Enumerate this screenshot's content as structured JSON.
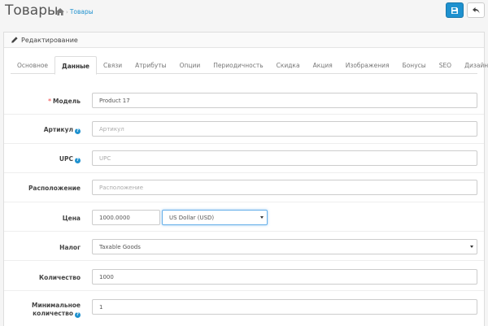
{
  "header": {
    "title": "Товары",
    "breadcrumb_sep": "›",
    "breadcrumb_link": "Товары"
  },
  "panel": {
    "title": "Редактирование"
  },
  "tabs": [
    {
      "label": "Основное",
      "active": false
    },
    {
      "label": "Данные",
      "active": true
    },
    {
      "label": "Связи",
      "active": false
    },
    {
      "label": "Атрибуты",
      "active": false
    },
    {
      "label": "Опции",
      "active": false
    },
    {
      "label": "Периодичность",
      "active": false
    },
    {
      "label": "Скидка",
      "active": false
    },
    {
      "label": "Акция",
      "active": false
    },
    {
      "label": "Изображения",
      "active": false
    },
    {
      "label": "Бонусы",
      "active": false
    },
    {
      "label": "SEO",
      "active": false
    },
    {
      "label": "Дизайн",
      "active": false
    }
  ],
  "form": {
    "model": {
      "label": "Модель",
      "required_mark": "*",
      "value": "Product 17"
    },
    "sku": {
      "label": "Артикул",
      "help": "?",
      "placeholder": "Артикул"
    },
    "upc": {
      "label": "UPC",
      "help": "?",
      "placeholder": "UPC"
    },
    "location": {
      "label": "Расположение",
      "placeholder": "Расположение"
    },
    "price": {
      "label": "Цена",
      "value": "1000.0000",
      "currency": "US Dollar (USD)"
    },
    "tax": {
      "label": "Налог",
      "value": "Taxable Goods"
    },
    "quantity": {
      "label": "Количество",
      "value": "1000"
    },
    "minimum": {
      "label_line1": "Минимальное",
      "label_line2": "количество",
      "help": "?",
      "value": "1"
    }
  },
  "colors": {
    "accent": "#1e91cf",
    "required": "#f56b6b"
  }
}
